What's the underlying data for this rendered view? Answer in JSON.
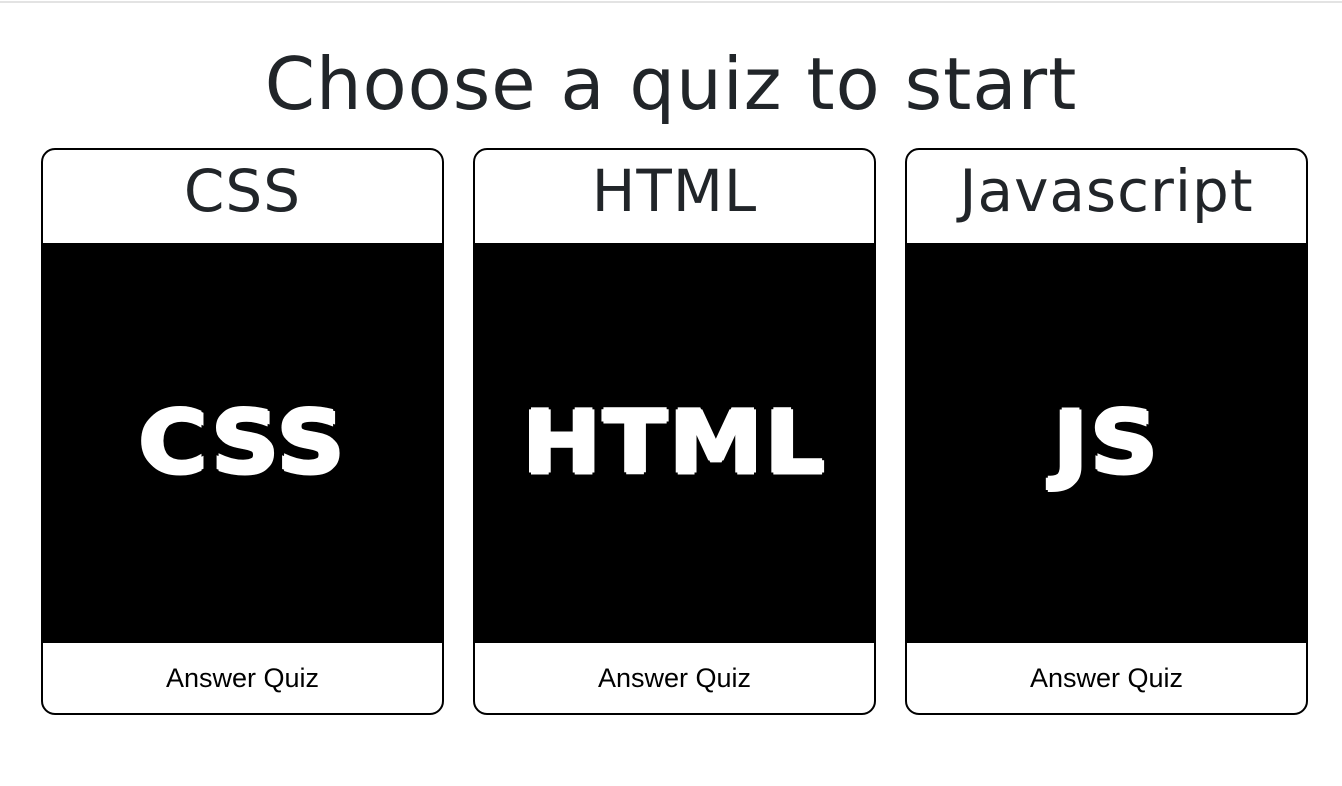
{
  "page": {
    "title": "Choose a quiz to start"
  },
  "quizzes": [
    {
      "name": "CSS",
      "logo_text": "CSS",
      "action_label": "Answer Quiz"
    },
    {
      "name": "HTML",
      "logo_text": "HTML",
      "action_label": "Answer Quiz"
    },
    {
      "name": "Javascript",
      "logo_text": "JS",
      "action_label": "Answer Quiz"
    }
  ],
  "colors": {
    "text": "#212529",
    "card_border": "#000000",
    "image_background": "#000000",
    "logo_text": "#ffffff",
    "background": "#ffffff"
  }
}
